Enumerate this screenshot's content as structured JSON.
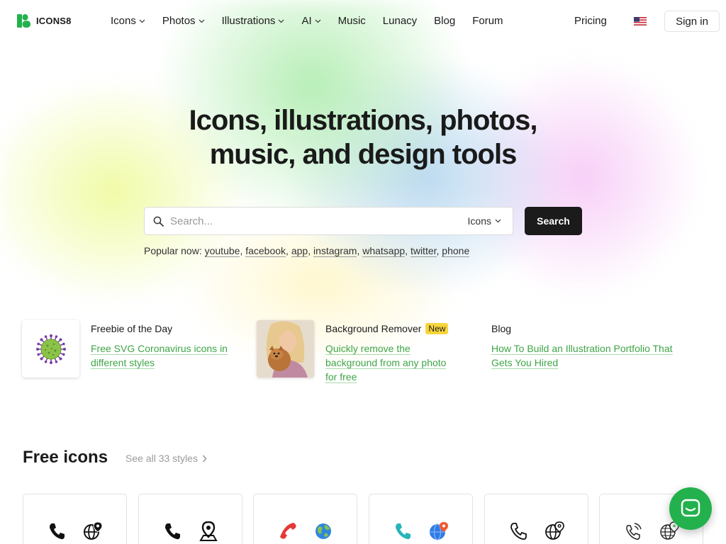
{
  "header": {
    "logo_text": "ICONS8",
    "nav": [
      {
        "label": "Icons",
        "dropdown": true
      },
      {
        "label": "Photos",
        "dropdown": true
      },
      {
        "label": "Illustrations",
        "dropdown": true
      },
      {
        "label": "AI",
        "dropdown": true
      },
      {
        "label": "Music",
        "dropdown": false
      },
      {
        "label": "Lunacy",
        "dropdown": false
      },
      {
        "label": "Blog",
        "dropdown": false
      },
      {
        "label": "Forum",
        "dropdown": false
      }
    ],
    "pricing_label": "Pricing",
    "flag_icon": "us-flag-icon",
    "signin_label": "Sign in"
  },
  "hero": {
    "title_line1": "Icons, illustrations, photos,",
    "title_line2": "music, and design tools"
  },
  "search": {
    "placeholder": "Search...",
    "value": "",
    "type_selected": "Icons",
    "button_label": "Search"
  },
  "popular": {
    "label": "Popular now:",
    "items": [
      "youtube",
      "facebook",
      "app",
      "instagram",
      "whatsapp",
      "twitter",
      "phone"
    ]
  },
  "features": [
    {
      "title": "Freebie of the Day",
      "badge": "",
      "link": "Free SVG Coronavirus icons in different styles",
      "link_lines": [
        "Free SVG Coronavirus icons in",
        "different styles"
      ],
      "image": "coronavirus-icon"
    },
    {
      "title": "Background Remover",
      "badge": "New",
      "link": "Quickly remove the background from any photo for free",
      "link_lines": [
        "Quickly remove the",
        "background from any photo",
        "for free"
      ],
      "image": "woman-with-dog-photo"
    },
    {
      "title": "Blog",
      "badge": "",
      "link": "How To Build an Illustration Portfolio That Gets You Hired",
      "link_lines": [
        "How To Build an Illustration Portfolio That",
        "Gets You Hired"
      ],
      "image": ""
    }
  ],
  "free_icons": {
    "title": "Free icons",
    "see_all_label": "See all 33 styles",
    "styles": [
      {
        "icons": [
          "phone-icon",
          "globe-pin-icon"
        ]
      },
      {
        "icons": [
          "phone-icon",
          "map-pin-icon"
        ]
      },
      {
        "icons": [
          "red-phone-icon",
          "earth-globe-icon"
        ]
      },
      {
        "icons": [
          "teal-phone-icon",
          "blue-globe-pin-icon"
        ]
      },
      {
        "icons": [
          "phone-outline-icon",
          "globe-pin-outline-icon"
        ]
      },
      {
        "icons": [
          "ringing-phone-icon",
          "globe-pin-outline-icon"
        ]
      }
    ]
  },
  "chat": {
    "icon": "chat-icon"
  },
  "colors": {
    "brand_green": "#23b14d",
    "link_green": "#3fa547",
    "dark": "#1b1b1b",
    "badge_yellow": "#f7d53b"
  }
}
